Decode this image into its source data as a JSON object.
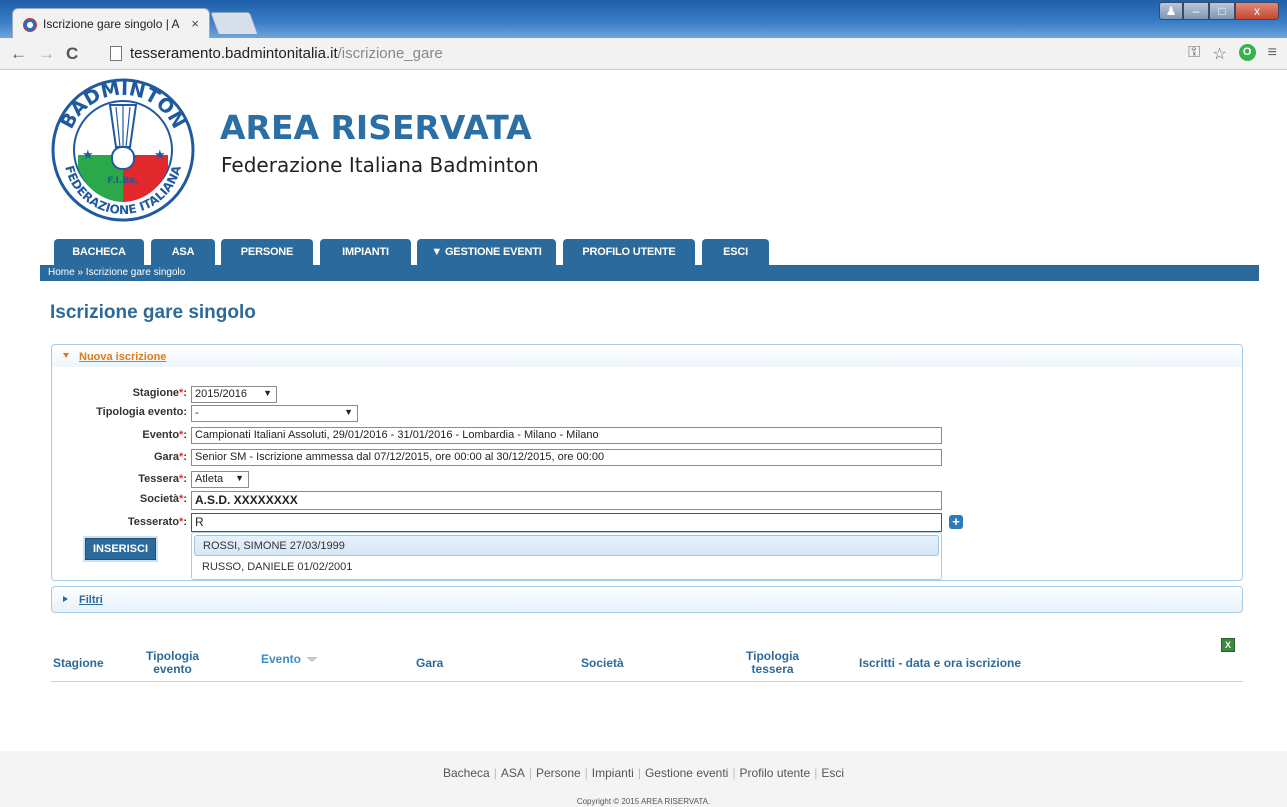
{
  "browser": {
    "tab_title": "Iscrizione gare singolo | A",
    "tab_close": "×",
    "url_host": "tesseramento.badmintonitalia.it",
    "url_path": "/iscrizione_gare",
    "window_buttons": {
      "minimize": "–",
      "maximize": "□",
      "close": "x",
      "user": "♟"
    }
  },
  "header": {
    "logo_top_text": "BADMINTON",
    "logo_bottom_text": "FEDERAZIONE ITALIANA",
    "logo_center_text": "F.I.Ba.",
    "title": "AREA RISERVATA",
    "subtitle": "Federazione Italiana Badminton"
  },
  "nav": {
    "tabs": [
      {
        "label": "BACHECA"
      },
      {
        "label": "ASA"
      },
      {
        "label": "PERSONE"
      },
      {
        "label": "IMPIANTI"
      },
      {
        "label": "▼ GESTIONE EVENTI"
      },
      {
        "label": "PROFILO UTENTE"
      },
      {
        "label": "ESCI"
      }
    ],
    "breadcrumb": "Home » Iscrizione gare singolo"
  },
  "main": {
    "heading": "Iscrizione gare singolo",
    "panel_new_title": "Nuova iscrizione",
    "panel_filter_title": "Filtri",
    "form": {
      "stagione_label": "Stagione",
      "stagione_value": "2015/2016",
      "tipologia_label": "Tipologia evento:",
      "tipologia_value": "-",
      "evento_label": "Evento",
      "evento_value": "Campionati Italiani Assoluti, 29/01/2016 - 31/01/2016 - Lombardia - Milano - Milano",
      "gara_label": "Gara",
      "gara_value": "Senior SM - Iscrizione ammessa dal 07/12/2015, ore 00:00 al 30/12/2015, ore 00:00",
      "tessera_label": "Tessera",
      "tessera_value": "Atleta",
      "societa_label": "Società",
      "societa_value": "A.S.D. XXXXXXXX",
      "tesserato_label": "Tesserato",
      "tesserato_value": "R",
      "required_mark": "*",
      "colon": ":",
      "dropdown_arrow": "▼",
      "insert_button": "INSERISCI",
      "plus_button": "+"
    },
    "autocomplete": [
      {
        "label": "ROSSI, SIMONE 27/03/1999"
      },
      {
        "label": "RUSSO, DANIELE 01/02/2001"
      }
    ],
    "table": {
      "columns": [
        {
          "label": "Stagione"
        },
        {
          "label": "Tipologia\nevento"
        },
        {
          "label": "Evento"
        },
        {
          "label": "Gara"
        },
        {
          "label": "Società"
        },
        {
          "label": "Tipologia\ntessera"
        },
        {
          "label": "Iscritti - data e ora iscrizione"
        }
      ],
      "export_icon": "X"
    }
  },
  "footer": {
    "links": [
      {
        "label": "Bacheca"
      },
      {
        "label": "ASA"
      },
      {
        "label": "Persone"
      },
      {
        "label": "Impianti"
      },
      {
        "label": "Gestione eventi"
      },
      {
        "label": "Profilo utente"
      },
      {
        "label": "Esci"
      }
    ],
    "separator": "|",
    "copyright": "Copyright © 2015 AREA RISERVATA."
  },
  "colors": {
    "brand_blue": "#2b6a9c",
    "accent_orange": "#e07c18",
    "required_red": "#e03030"
  }
}
